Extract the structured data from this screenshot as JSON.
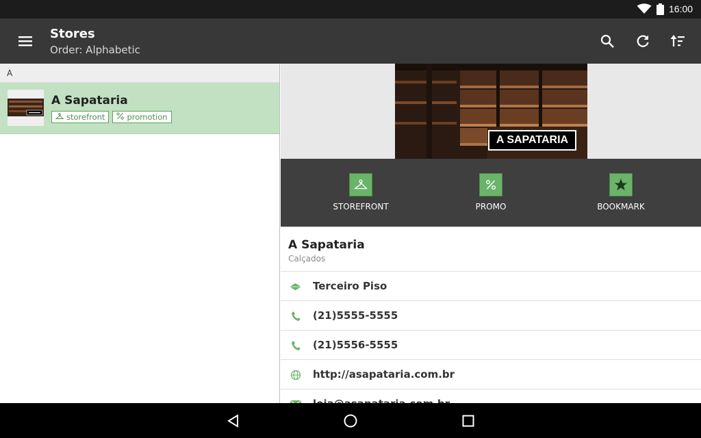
{
  "status_bar": {
    "time": "16:00"
  },
  "app_bar": {
    "title": "Stores",
    "subtitle": "Order: Alphabetic"
  },
  "list": {
    "section_letter": "A",
    "items": [
      {
        "name": "A Sapataria",
        "tags": [
          "storefront",
          "promotion"
        ]
      }
    ]
  },
  "detail": {
    "hero_sign": "A SAPATARIA",
    "actions": {
      "storefront": "STOREFRONT",
      "promo": "PROMO",
      "bookmark": "BOOKMARK"
    },
    "name": "A Sapataria",
    "category": "Calçados",
    "rows": [
      "Terceiro Piso",
      "(21)5555-5555",
      "(21)5556-5555",
      "http://asapataria.com.br",
      "loja@asapataria.com.br"
    ]
  },
  "colors": {
    "accent": "#6ab46a",
    "app_bar": "#383838",
    "selected_row": "#c2e1c2",
    "action_strip": "#3f3f3f"
  }
}
